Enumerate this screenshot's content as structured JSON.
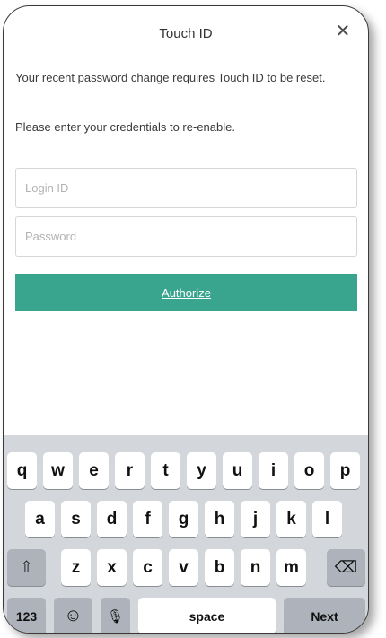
{
  "header": {
    "title": "Touch ID",
    "close_glyph": "✕"
  },
  "message": {
    "line1": "Your recent password change requires Touch ID to be reset.",
    "line2": "Please enter your credentials to re-enable."
  },
  "form": {
    "login_placeholder": "Login ID",
    "login_value": "",
    "password_placeholder": "Password",
    "password_value": "",
    "authorize_label": "Authorize"
  },
  "keyboard": {
    "row1": [
      "q",
      "w",
      "e",
      "r",
      "t",
      "y",
      "u",
      "i",
      "o",
      "p"
    ],
    "row2": [
      "a",
      "s",
      "d",
      "f",
      "g",
      "h",
      "j",
      "k",
      "l"
    ],
    "row3": [
      "z",
      "x",
      "c",
      "v",
      "b",
      "n",
      "m"
    ],
    "shift_glyph": "⇧",
    "delete_glyph": "⌫",
    "numbers_label": "123",
    "emoji_glyph": "☺",
    "mic_glyph": "🎙",
    "space_label": "space",
    "next_label": "Next"
  },
  "colors": {
    "accent": "#3aa58f",
    "keyboard_bg": "#d3d6db",
    "key_bg": "#ffffff",
    "key_gray": "#adb2bb"
  }
}
